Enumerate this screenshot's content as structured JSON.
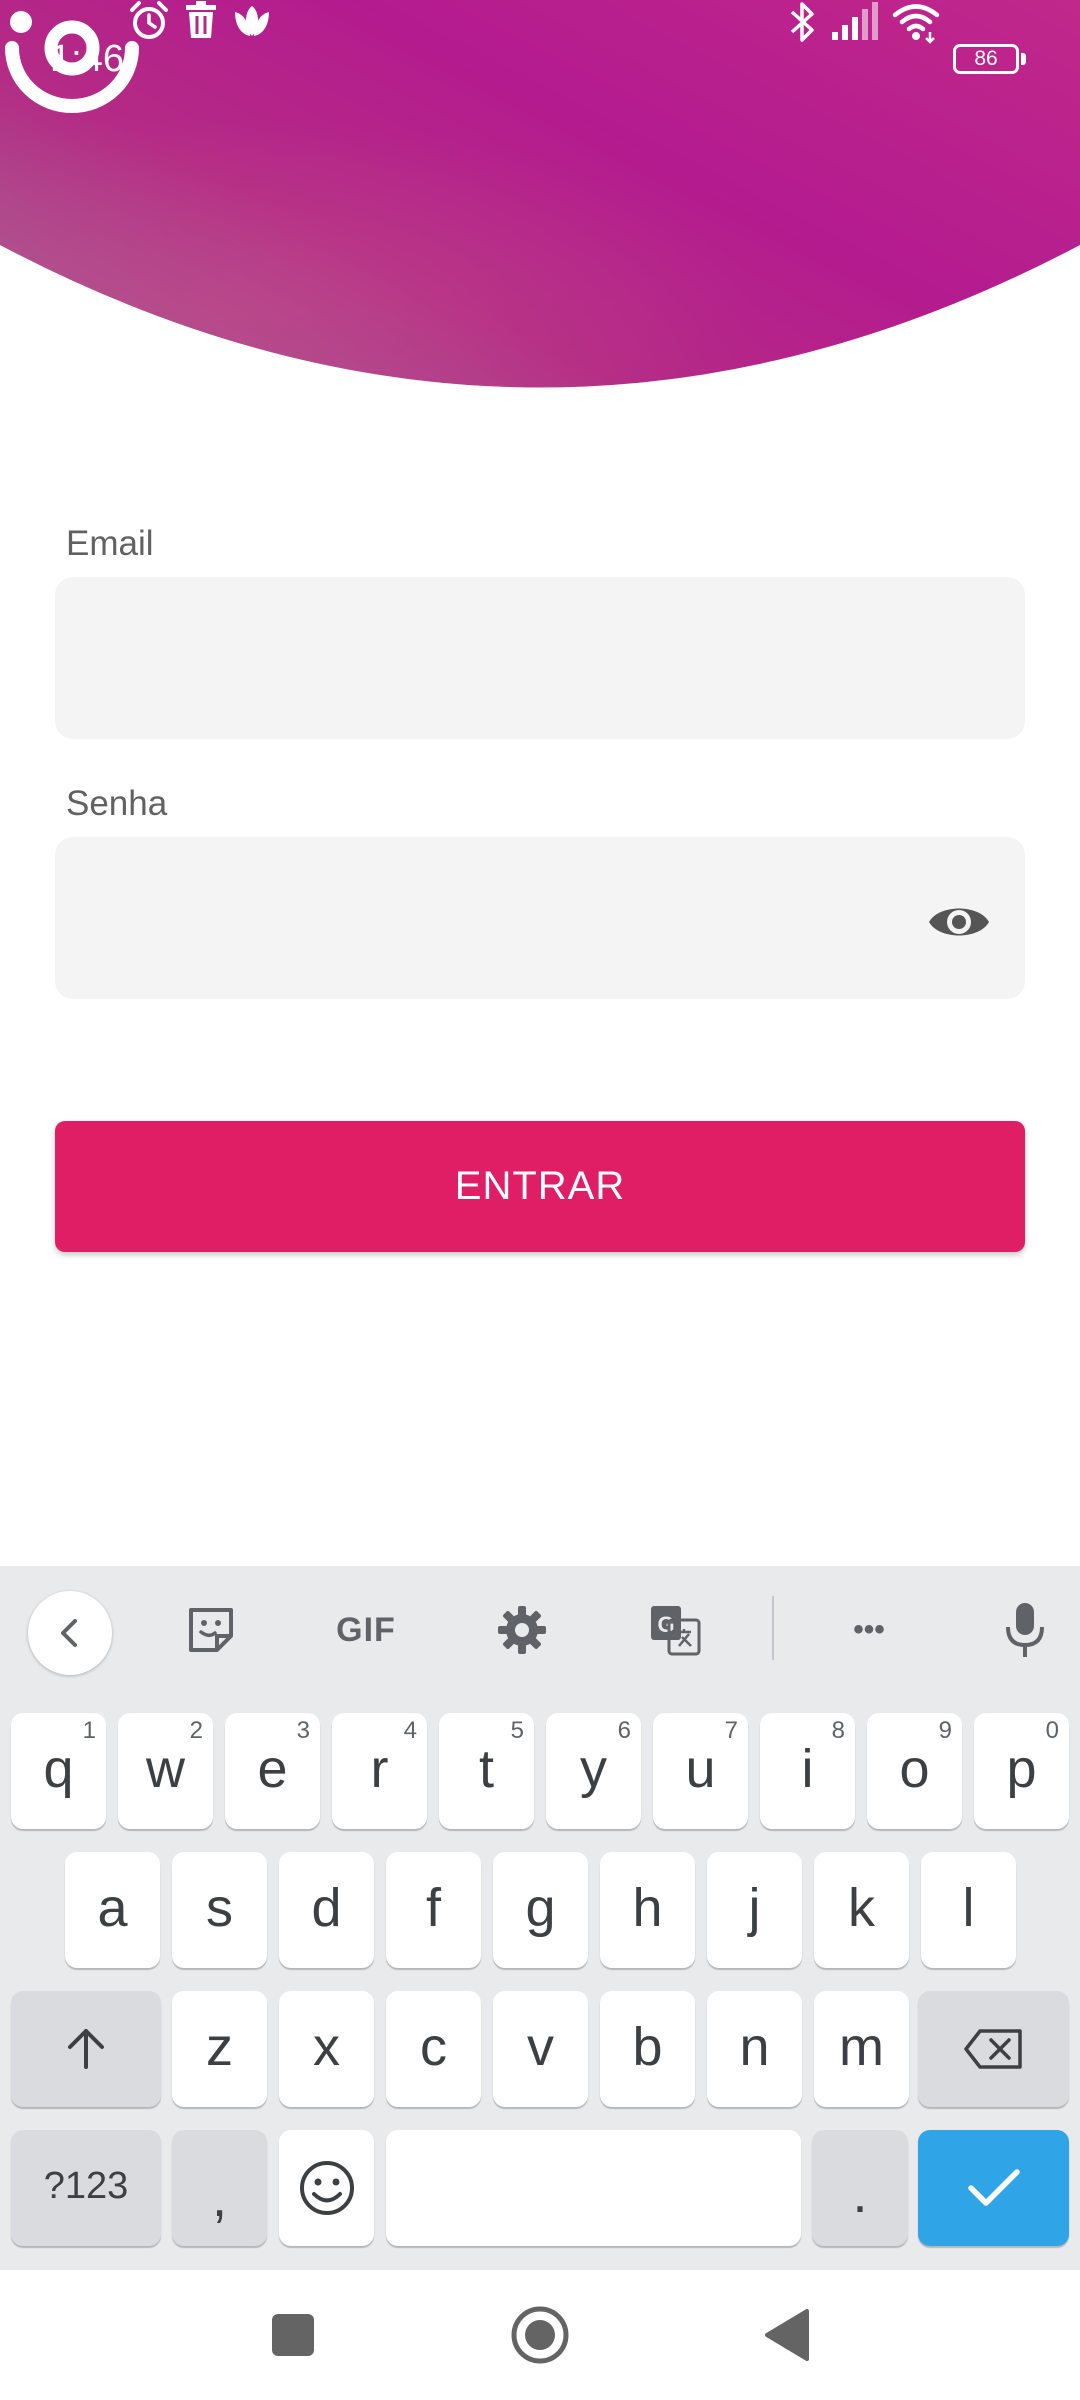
{
  "status_bar": {
    "time": "1:46",
    "left_icons": [
      "alarm-icon",
      "trash-icon",
      "lotus-icon"
    ],
    "right_icons": [
      "bluetooth-icon",
      "signal-icon",
      "wifi-icon",
      "battery-icon"
    ],
    "battery": "86"
  },
  "header": {
    "colors": {
      "gradient_start": "#a83f86",
      "gradient_mid": "#b51f8f",
      "gradient_end": "#c4278e",
      "logo": "#ffffff"
    },
    "logo_icon": "app-logo-icon"
  },
  "form": {
    "email_label": "Email",
    "email_value": "",
    "password_label": "Senha",
    "password_value": "",
    "password_toggle_icon": "eye-icon",
    "submit_label": "ENTRAR",
    "submit_color": "#e01e65"
  },
  "keyboard": {
    "toolbar": [
      "chevron-left-icon",
      "sticker-icon",
      "GIF",
      "gear-icon",
      "translate-icon",
      "more-icon",
      "microphone-icon"
    ],
    "gif_label": "GIF",
    "more_label": "•••",
    "row1": [
      {
        "key": "q",
        "hint": "1"
      },
      {
        "key": "w",
        "hint": "2"
      },
      {
        "key": "e",
        "hint": "3"
      },
      {
        "key": "r",
        "hint": "4"
      },
      {
        "key": "t",
        "hint": "5"
      },
      {
        "key": "y",
        "hint": "6"
      },
      {
        "key": "u",
        "hint": "7"
      },
      {
        "key": "i",
        "hint": "8"
      },
      {
        "key": "o",
        "hint": "9"
      },
      {
        "key": "p",
        "hint": "0"
      }
    ],
    "row2": [
      "a",
      "s",
      "d",
      "f",
      "g",
      "h",
      "j",
      "k",
      "l"
    ],
    "row3": [
      "z",
      "x",
      "c",
      "v",
      "b",
      "n",
      "m"
    ],
    "symbols_label": "?123",
    "comma_label": ",",
    "period_label": ".",
    "enter_color": "#2fa4e6"
  },
  "nav_bar": {
    "buttons": [
      "recents-icon",
      "home-icon",
      "back-icon"
    ]
  }
}
